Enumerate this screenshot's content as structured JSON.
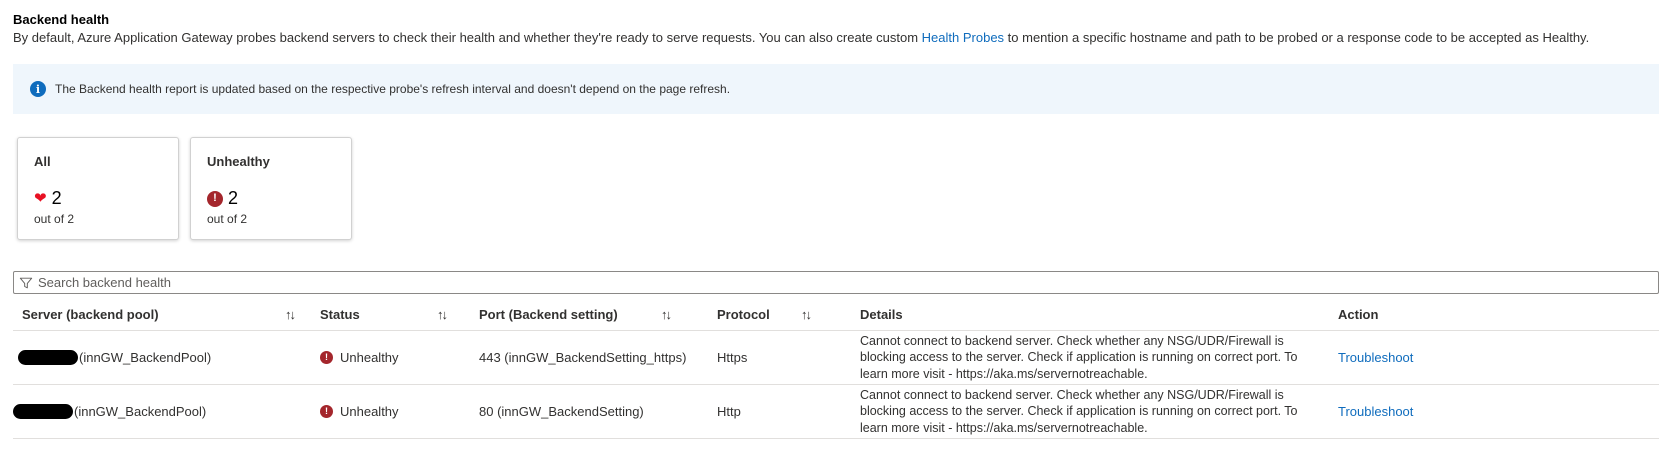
{
  "header": {
    "title": "Backend health",
    "description_before": "By default, Azure Application Gateway probes backend servers to check their health and whether they're ready to serve requests. You can also create custom ",
    "description_link": "Health Probes",
    "description_after": " to mention a specific hostname and path to be probed or a response code to be accepted as Healthy."
  },
  "banner": {
    "icon": "info-icon",
    "message": "The Backend health report is updated based on the respective probe's refresh interval and doesn't depend on the page refresh."
  },
  "cards": [
    {
      "title": "All",
      "icon": "heart-icon",
      "count": "2",
      "sub": "out of 2"
    },
    {
      "title": "Unhealthy",
      "icon": "error-icon",
      "count": "2",
      "sub": "out of 2"
    }
  ],
  "search": {
    "placeholder": "Search backend health"
  },
  "table": {
    "columns": [
      {
        "label": "Server (backend pool)",
        "sortable": true
      },
      {
        "label": "Status",
        "sortable": true
      },
      {
        "label": "Port (Backend setting)",
        "sortable": true
      },
      {
        "label": "Protocol",
        "sortable": true
      },
      {
        "label": "Details",
        "sortable": false
      },
      {
        "label": "Action",
        "sortable": false
      }
    ],
    "sort_glyph": "↑↓",
    "rows": [
      {
        "server": "(innGW_BackendPool)",
        "status": "Unhealthy",
        "port": "443 (innGW_BackendSetting_https)",
        "protocol": "Https",
        "details": "Cannot connect to backend server. Check whether any NSG/UDR/Firewall is blocking access to the server. Check if application is running on correct port. To learn more visit - https://aka.ms/servernotreachable.",
        "action": "Troubleshoot"
      },
      {
        "server": "(innGW_BackendPool)",
        "status": "Unhealthy",
        "port": "80 (innGW_BackendSetting)",
        "protocol": "Http",
        "details": "Cannot connect to backend server. Check whether any NSG/UDR/Firewall is blocking access to the server. Check if application is running on correct port. To learn more visit - https://aka.ms/servernotreachable.",
        "action": "Troubleshoot"
      }
    ]
  },
  "colors": {
    "link": "#0f6cbd",
    "banner_bg": "#eff6fc",
    "error": "#a4262c",
    "heart": "#e81123"
  }
}
